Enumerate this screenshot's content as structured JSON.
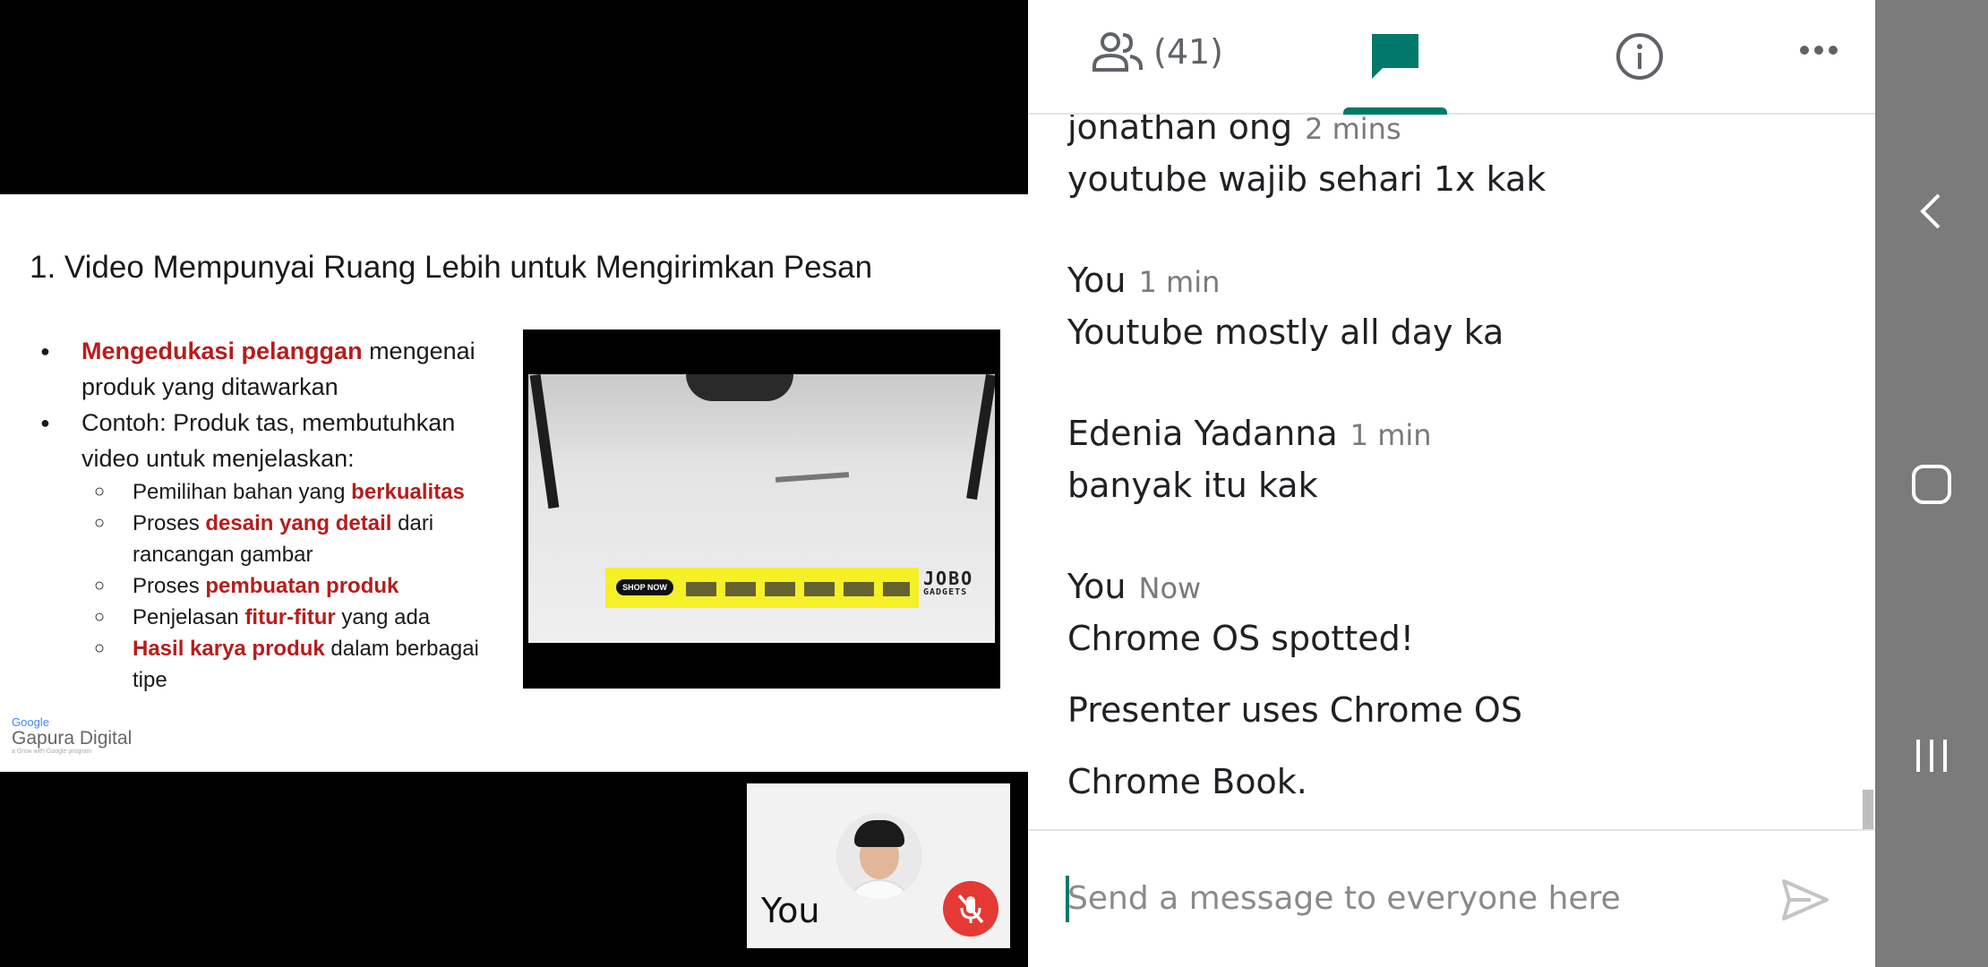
{
  "slide": {
    "title": "1. Video Mempunyai Ruang Lebih untuk Mengirimkan Pesan",
    "bullet1": {
      "highlight": "Mengedukasi pelanggan",
      "rest": " mengenai produk yang ditawarkan"
    },
    "bullet2": {
      "text": "Contoh: Produk tas, membutuhkan video untuk menjelaskan:"
    },
    "sub1": {
      "pre": "Pemilihan bahan yang ",
      "highlight": "berkualitas"
    },
    "sub2": {
      "pre": "Proses ",
      "highlight": "desain yang detail",
      "post": " dari rancangan gambar"
    },
    "sub3": {
      "pre": "Proses ",
      "highlight": "pembuatan produk"
    },
    "sub4": {
      "pre": "Penjelasan ",
      "highlight": "fitur-fitur",
      "post": " yang ada"
    },
    "sub5": {
      "highlight": "Hasil karya produk",
      "post": " dalam berbagai tipe"
    },
    "video": {
      "ad_button": "SHOP NOW",
      "brand": "JOBO",
      "brand_sub": "GADGETS"
    },
    "logo": {
      "google": "Google",
      "name": "Gapura Digital",
      "tagline": "a Grow with Google program"
    }
  },
  "self_tile": {
    "label": "You"
  },
  "header": {
    "people_count": "(41)"
  },
  "messages": [
    {
      "sender": "jonathan ong",
      "time": "2 mins",
      "lines": [
        "youtube wajib sehari 1x kak"
      ]
    },
    {
      "sender": "You",
      "time": "1 min",
      "lines": [
        "Youtube mostly all day ka"
      ]
    },
    {
      "sender": "Edenia Yadanna",
      "time": "1 min",
      "lines": [
        "banyak itu kak"
      ]
    },
    {
      "sender": "You",
      "time": "Now",
      "lines": [
        "Chrome OS spotted!",
        "Presenter uses Chrome OS",
        "Chrome Book."
      ]
    }
  ],
  "input": {
    "placeholder": "Send a message to everyone here"
  },
  "colors": {
    "accent": "#00796b",
    "highlight_red": "#b71c1c",
    "mic_off_red": "#e53935"
  }
}
